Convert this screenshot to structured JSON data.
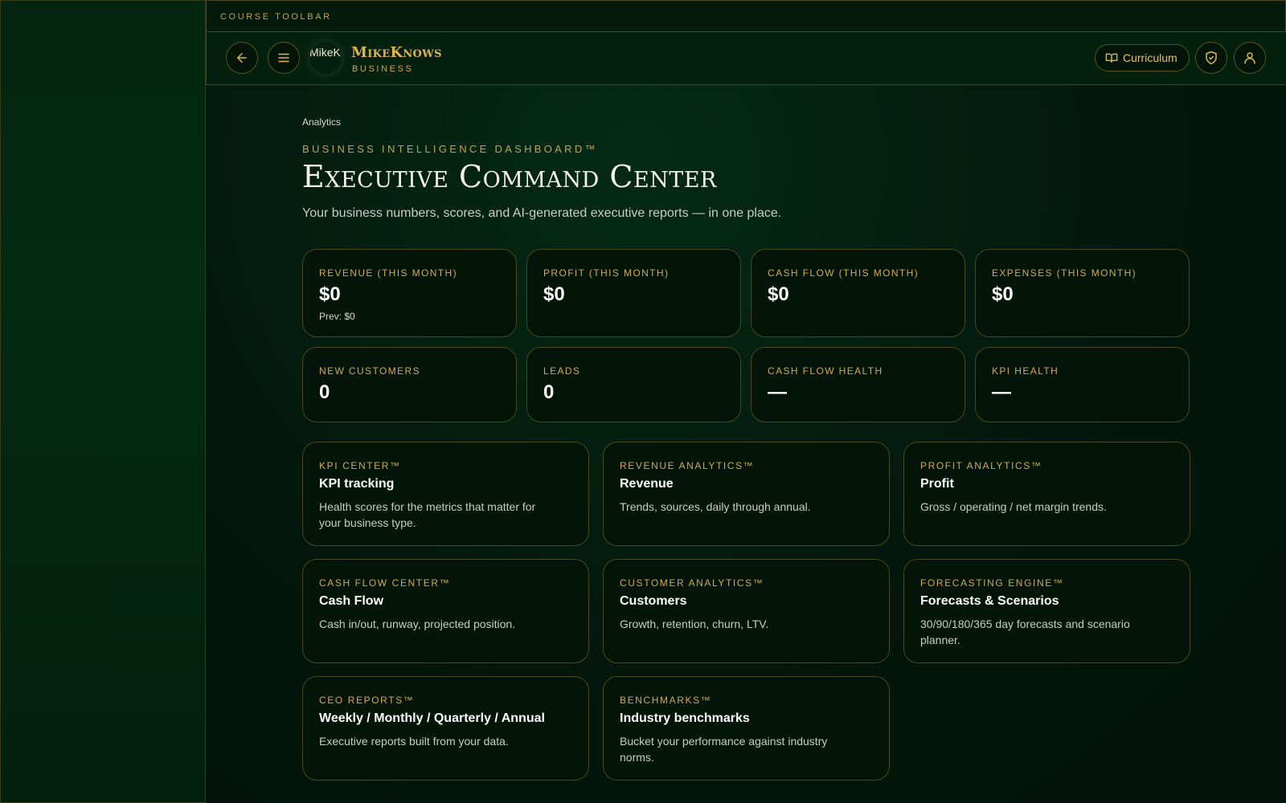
{
  "toolbar": {
    "label": "COURSE TOOLBAR"
  },
  "header": {
    "logo_alt": "MikeKnows",
    "brand_name": "MikeKnows",
    "brand_sub": "BUSINESS",
    "curriculum_label": "Curriculum",
    "icons": [
      "arrow-left-icon",
      "menu-icon",
      "book-icon",
      "shield-check-icon",
      "user-icon"
    ]
  },
  "page": {
    "breadcrumb": "Analytics",
    "eyebrow": "BUSINESS INTELLIGENCE DASHBOARD™",
    "title": "Executive Command Center",
    "subtitle": "Your business numbers, scores, and AI-generated executive reports — in one place."
  },
  "stats": [
    {
      "label": "REVENUE (THIS MONTH)",
      "value": "$0",
      "prev": "Prev: $0"
    },
    {
      "label": "PROFIT (THIS MONTH)",
      "value": "$0"
    },
    {
      "label": "CASH FLOW (THIS MONTH)",
      "value": "$0"
    },
    {
      "label": "EXPENSES (THIS MONTH)",
      "value": "$0"
    },
    {
      "label": "NEW CUSTOMERS",
      "value": "0"
    },
    {
      "label": "LEADS",
      "value": "0"
    },
    {
      "label": "CASH FLOW HEALTH",
      "value": "—"
    },
    {
      "label": "KPI HEALTH",
      "value": "—"
    }
  ],
  "features": [
    {
      "label": "KPI CENTER™",
      "title": "KPI tracking",
      "desc": "Health scores for the metrics that matter for your business type."
    },
    {
      "label": "REVENUE ANALYTICS™",
      "title": "Revenue",
      "desc": "Trends, sources, daily through annual."
    },
    {
      "label": "PROFIT ANALYTICS™",
      "title": "Profit",
      "desc": "Gross / operating / net margin trends."
    },
    {
      "label": "CASH FLOW CENTER™",
      "title": "Cash Flow",
      "desc": "Cash in/out, runway, projected position."
    },
    {
      "label": "CUSTOMER ANALYTICS™",
      "title": "Customers",
      "desc": "Growth, retention, churn, LTV."
    },
    {
      "label": "FORECASTING ENGINE™",
      "title": "Forecasts & Scenarios",
      "desc": "30/90/180/365 day forecasts and scenario planner."
    },
    {
      "label": "CEO REPORTS™",
      "title": "Weekly / Monthly / Quarterly / Annual",
      "desc": "Executive reports built from your data."
    },
    {
      "label": "BENCHMARKS™",
      "title": "Industry benchmarks",
      "desc": "Bucket your performance against industry norms."
    }
  ],
  "colors": {
    "accent": "#d5aa45",
    "background": "#03170d",
    "border": "#4c4816"
  }
}
